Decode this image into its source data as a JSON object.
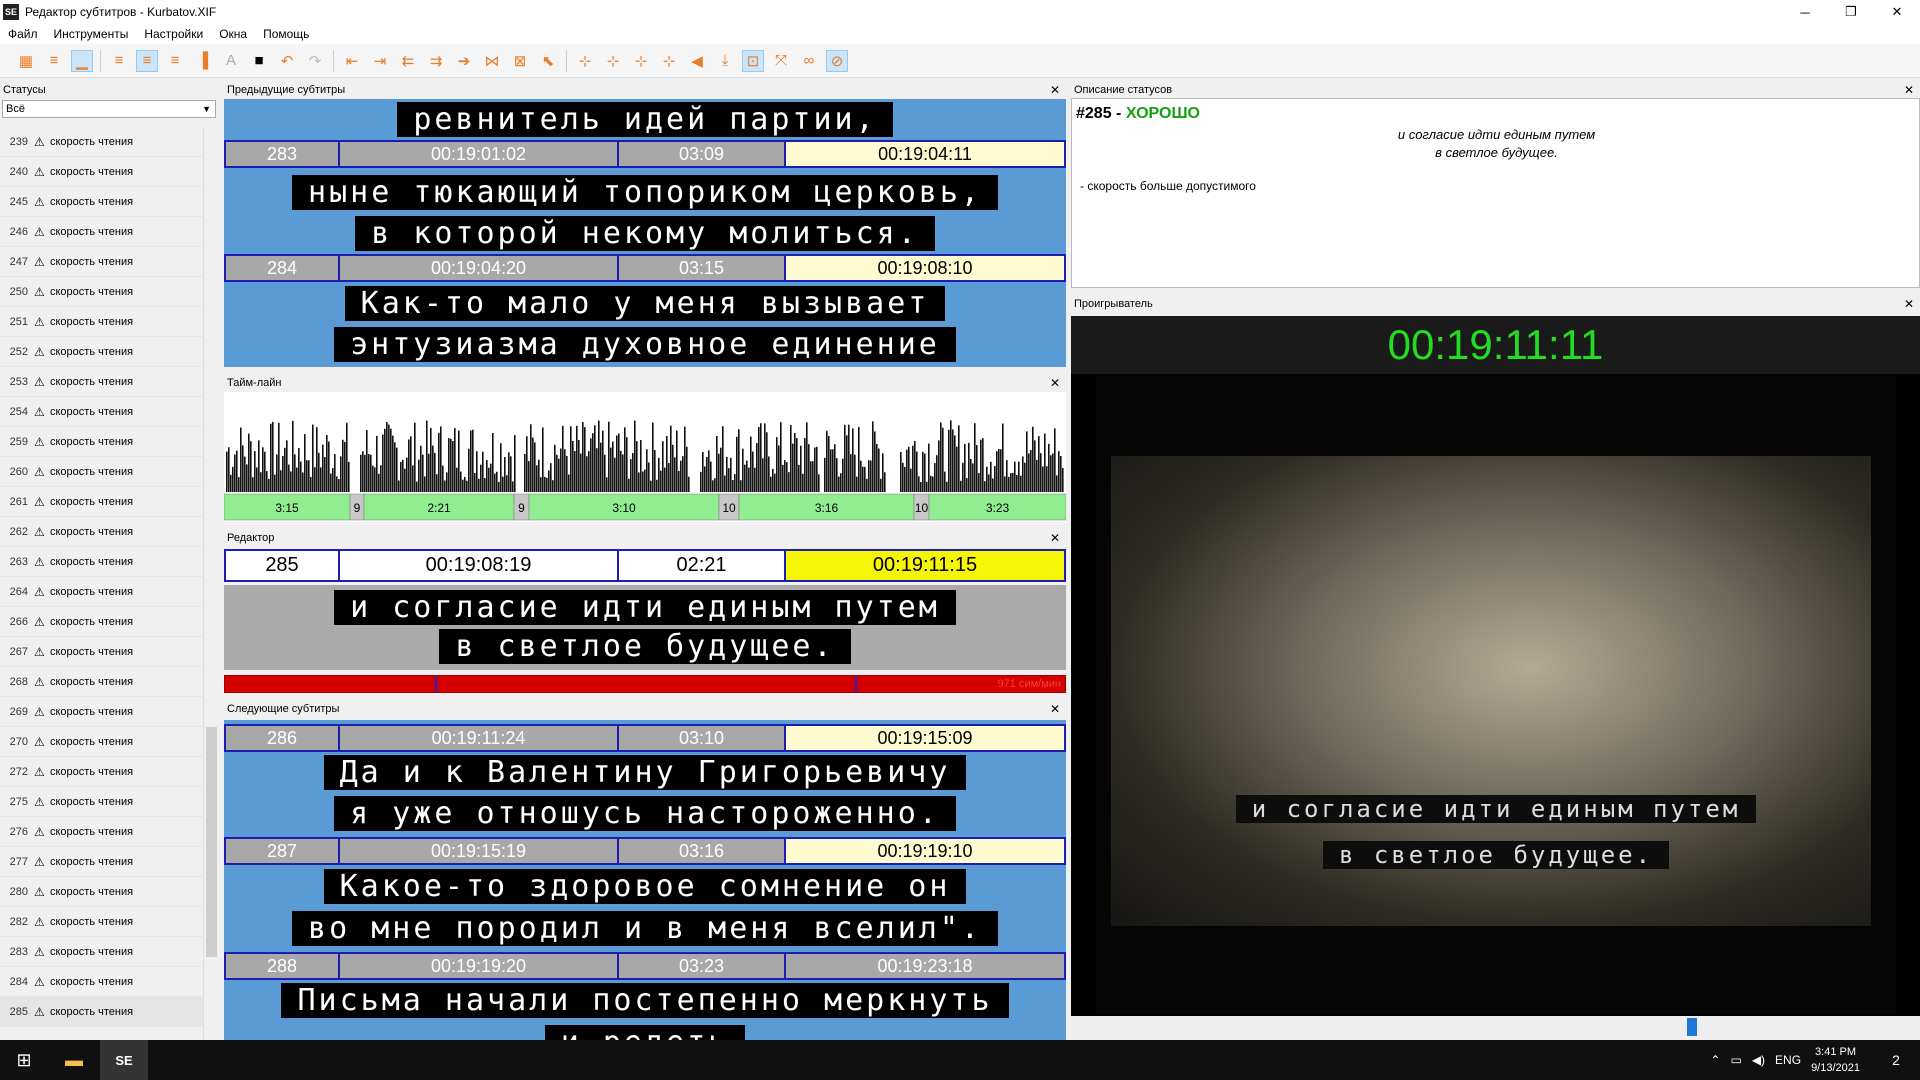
{
  "window": {
    "title": "Редактор субтитров - Kurbatov.XIF",
    "app_icon": "SE"
  },
  "menu": [
    "Файл",
    "Инструменты",
    "Настройки",
    "Окна",
    "Помощь"
  ],
  "panels": {
    "statuses": "Статусы",
    "previous": "Предыдущие субтитры",
    "timeline": "Тайм-лайн",
    "editor": "Редактор",
    "next": "Следующие субтитры",
    "status_desc": "Описание статусов",
    "player": "Проигрыватель"
  },
  "status_filter": "Всё",
  "status_items": [
    {
      "num": "239",
      "label": "скорость чтения"
    },
    {
      "num": "240",
      "label": "скорость чтения"
    },
    {
      "num": "245",
      "label": "скорость чтения"
    },
    {
      "num": "246",
      "label": "скорость чтения"
    },
    {
      "num": "247",
      "label": "скорость чтения"
    },
    {
      "num": "250",
      "label": "скорость чтения"
    },
    {
      "num": "251",
      "label": "скорость чтения"
    },
    {
      "num": "252",
      "label": "скорость чтения"
    },
    {
      "num": "253",
      "label": "скорость чтения"
    },
    {
      "num": "254",
      "label": "скорость чтения"
    },
    {
      "num": "259",
      "label": "скорость чтения"
    },
    {
      "num": "260",
      "label": "скорость чтения"
    },
    {
      "num": "261",
      "label": "скорость чтения"
    },
    {
      "num": "262",
      "label": "скорость чтения"
    },
    {
      "num": "263",
      "label": "скорость чтения"
    },
    {
      "num": "264",
      "label": "скорость чтения"
    },
    {
      "num": "266",
      "label": "скорость чтения"
    },
    {
      "num": "267",
      "label": "скорость чтения"
    },
    {
      "num": "268",
      "label": "скорость чтения"
    },
    {
      "num": "269",
      "label": "скорость чтения"
    },
    {
      "num": "270",
      "label": "скорость чтения"
    },
    {
      "num": "272",
      "label": "скорость чтения"
    },
    {
      "num": "275",
      "label": "скорость чтения"
    },
    {
      "num": "276",
      "label": "скорость чтения"
    },
    {
      "num": "277",
      "label": "скорость чтения"
    },
    {
      "num": "280",
      "label": "скорость чтения"
    },
    {
      "num": "282",
      "label": "скорость чтения"
    },
    {
      "num": "283",
      "label": "скорость чтения"
    },
    {
      "num": "284",
      "label": "скорость чтения"
    },
    {
      "num": "285",
      "label": "скорость чтения"
    }
  ],
  "previous": {
    "top_line": "ревнитель идей партии,",
    "s283": {
      "num": "283",
      "start": "00:19:01:02",
      "dur": "03:09",
      "end": "00:19:04:11",
      "l1": "ныне тюкающий топориком церковь,",
      "l2": "в которой некому молиться."
    },
    "s284": {
      "num": "284",
      "start": "00:19:04:20",
      "dur": "03:15",
      "end": "00:19:08:10",
      "l1": "Как-то мало у меня вызывает",
      "l2": "энтузиазма духовное единение"
    }
  },
  "timeline_segments": [
    "3:15",
    "9",
    "2:21",
    "9",
    "3:10",
    "10",
    "3:16",
    "10",
    "3:23"
  ],
  "editor": {
    "num": "285",
    "start": "00:19:08:19",
    "dur": "02:21",
    "end": "00:19:11:15",
    "l1": "и согласие идти единым путем",
    "l2": "в светлое будущее.",
    "speed": "971 сим/мин"
  },
  "next": {
    "s286": {
      "num": "286",
      "start": "00:19:11:24",
      "dur": "03:10",
      "end": "00:19:15:09",
      "l1": "Да и к Валентину Григорьевичу",
      "l2": "я уже отношусь настороженно."
    },
    "s287": {
      "num": "287",
      "start": "00:19:15:19",
      "dur": "03:16",
      "end": "00:19:19:10",
      "l1": "Какое-то здоровое сомнение он",
      "l2": "во мне породил и в меня вселил\"."
    },
    "s288": {
      "num": "288",
      "start": "00:19:19:20",
      "dur": "03:23",
      "end": "00:19:23:18",
      "l1": "Письма начали постепенно меркнуть",
      "l2": "и редеть"
    }
  },
  "status_desc": {
    "num": "#285",
    "dash": "-",
    "state": "ХОРОШО",
    "l1": "и согласие идти единым путем",
    "l2": "в светлое будущее.",
    "note": "- скорость больше допустимого"
  },
  "player": {
    "timecode": "00:19:11:11",
    "sub1": "и согласие идти единым путем",
    "sub2": "в светлое будущее."
  },
  "taskbar": {
    "lang": "ENG",
    "time": "3:41 PM",
    "date": "9/13/2021",
    "notif": "2"
  },
  "colors": {
    "accent_orange": "#e87d2a",
    "subtitle_bg": "#5b9bd5",
    "frame_border": "#1d1db0",
    "timecode": "#22dd22",
    "speed_bad": "#d40000",
    "good": "#12a012"
  }
}
